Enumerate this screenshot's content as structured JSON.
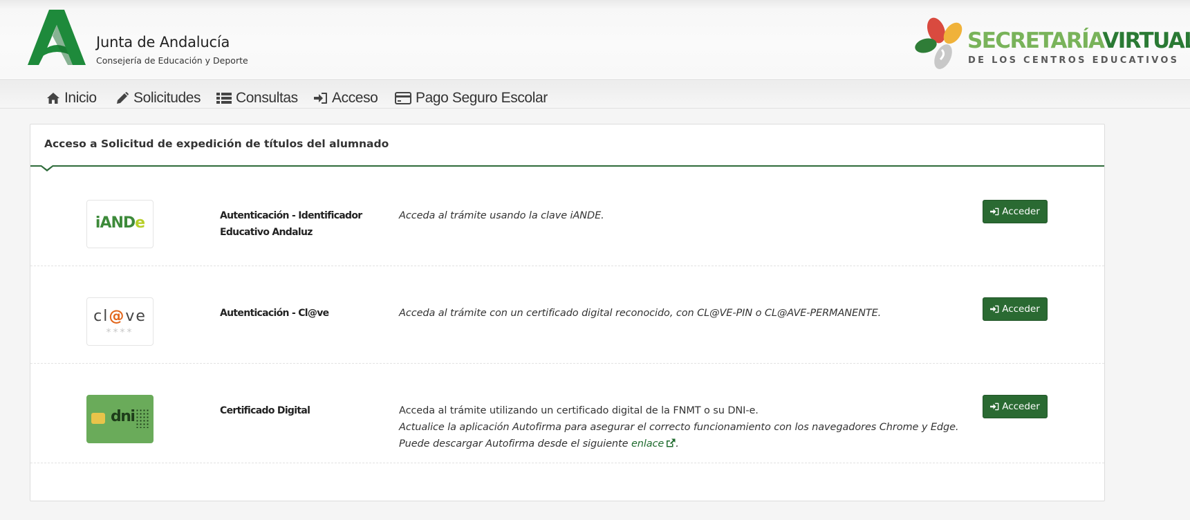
{
  "header": {
    "org_title": "Junta de Andalucía",
    "org_subtitle": "Consejería de Educación y Deporte",
    "app_title_part1": "SECRETARÍA",
    "app_title_part2": "VIRTUAL",
    "app_subtitle": "DE LOS CENTROS EDUCATIVOS",
    "colors": {
      "ja_green": "#1e8a3b",
      "sv_light_green": "#79b35a",
      "sv_dark_green": "#2a7a34"
    }
  },
  "nav": {
    "items": [
      {
        "label": "Inicio",
        "icon": "home-icon"
      },
      {
        "label": "Solicitudes",
        "icon": "pencil-icon"
      },
      {
        "label": "Consultas",
        "icon": "list-icon"
      },
      {
        "label": "Acceso",
        "icon": "sign-in-icon"
      },
      {
        "label": "Pago Seguro Escolar",
        "icon": "credit-card-icon"
      }
    ]
  },
  "panel": {
    "title": "Acceso a Solicitud de expedición de títulos del alumnado",
    "accent_color": "#2e6b3a",
    "options": [
      {
        "title": "Autenticación - Identificador Educativo Andaluz",
        "logo_text": "iANDe",
        "desc_italic_1": "Acceda al trámite usando la clave iANDE.",
        "button": "Acceder"
      },
      {
        "title": "Autenticación - Cl@ve",
        "logo_text": "cl@ve",
        "logo_stars": "****",
        "desc_italic_1": "Acceda al trámite con un certificado digital reconocido, con CL@VE-PIN o CL@AVE-PERMANENTE.",
        "button": "Acceder"
      },
      {
        "title": "Certificado Digital",
        "logo_text": "dni",
        "desc_normal": "Acceda al trámite utilizando un certificado digital de la FNMT o su DNI-e.",
        "desc_italic_1": "Actualice la aplicación Autofirma para asegurar el correcto funcionamiento con los navegadores Chrome y Edge.",
        "desc_italic_2_prefix": "Puede descargar Autofirma desde el siguiente ",
        "desc_link": "enlace",
        "desc_suffix": ".",
        "button": "Acceder"
      }
    ]
  }
}
